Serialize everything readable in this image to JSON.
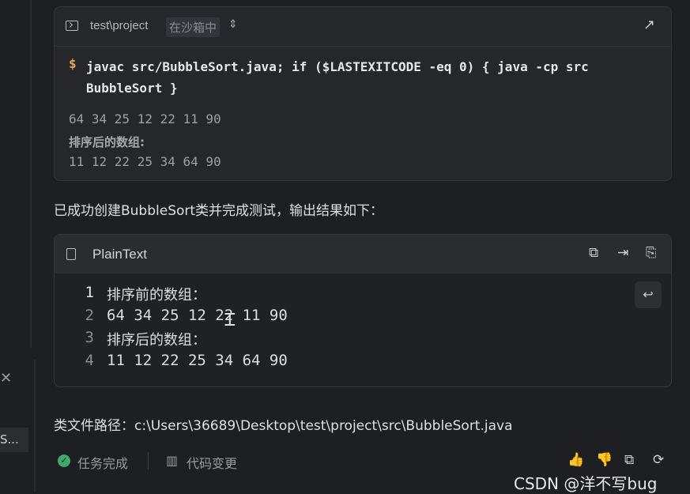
{
  "left_panel": {
    "close_glyph": "✕",
    "tab_label": "S..."
  },
  "terminal": {
    "path": "test\\project",
    "sandbox_badge": "在沙箱中",
    "prompt": "$",
    "command_line1": "javac src/BubbleSort.java; if ($LASTEXITCODE -eq 0) { java -cp src",
    "command_line2": "BubbleSort }",
    "output": [
      "64 34 25 12 22 11 90",
      "排序后的数组:",
      "11 12 22 25 34 64 90"
    ],
    "icons": [
      "terminal-icon",
      "chevron-updown-icon",
      "expand-icon"
    ]
  },
  "message_intro": "已成功创建BubbleSort类并完成测试，输出结果如下：",
  "code_block": {
    "language": "PlainText",
    "lines": [
      {
        "num": "1",
        "text": "排序前的数组："
      },
      {
        "num": "2",
        "text": "64 34 25 12 22 11 90"
      },
      {
        "num": "3",
        "text": "排序后的数组："
      },
      {
        "num": "4",
        "text": "11 12 22 25 34 64 90"
      }
    ],
    "active_line": 1,
    "icons": [
      "file-icon",
      "copy-icon",
      "insert-icon",
      "new-file-icon",
      "wrap-toggle-icon"
    ]
  },
  "message_path": "类文件路径：c:\\Users\\36689\\Desktop\\test\\project\\src\\BubbleSort.java",
  "footer": {
    "status_label": "任务完成",
    "changes_label": "代码变更",
    "status_color": "#3fa86b",
    "icons": [
      "check-circle-icon",
      "code-change-icon",
      "thumbs-up-icon",
      "thumbs-down-icon",
      "copy-icon",
      "refresh-icon"
    ]
  },
  "watermark": "CSDN @洋不写bug"
}
